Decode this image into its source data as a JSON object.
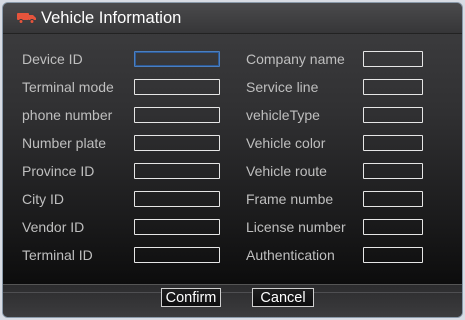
{
  "dialog": {
    "title": "Vehicle Information",
    "icon": "truck-icon",
    "accent_color": "#e5543c"
  },
  "left_fields": [
    {
      "label": "Device ID",
      "value": ""
    },
    {
      "label": "Terminal mode",
      "value": ""
    },
    {
      "label": "phone number",
      "value": ""
    },
    {
      "label": "Number plate",
      "value": ""
    },
    {
      "label": "Province ID",
      "value": ""
    },
    {
      "label": "City ID",
      "value": ""
    },
    {
      "label": "Vendor ID",
      "value": ""
    },
    {
      "label": "Terminal ID",
      "value": ""
    }
  ],
  "right_fields": [
    {
      "label": "Company name",
      "value": ""
    },
    {
      "label": "Service line",
      "value": ""
    },
    {
      "label": "vehicleType",
      "value": ""
    },
    {
      "label": "Vehicle color",
      "value": ""
    },
    {
      "label": "Vehicle route",
      "value": ""
    },
    {
      "label": "Frame numbe",
      "value": ""
    },
    {
      "label": "License number",
      "value": ""
    },
    {
      "label": "Authentication",
      "value": ""
    }
  ],
  "buttons": {
    "confirm": "Confirm",
    "cancel": "Cancel"
  }
}
